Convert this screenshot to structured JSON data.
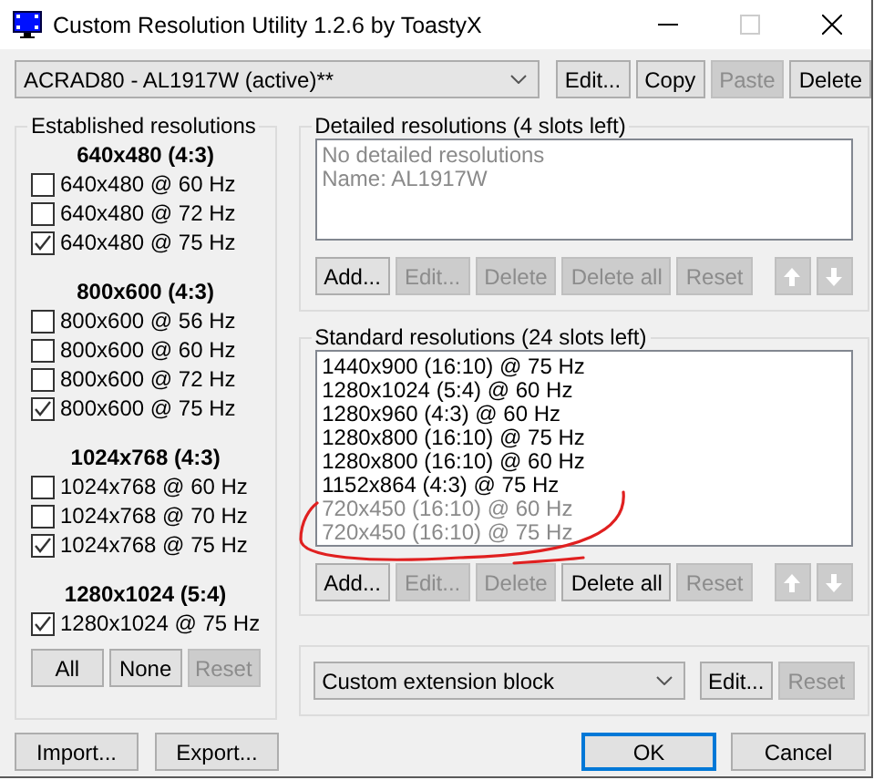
{
  "window": {
    "title": "Custom Resolution Utility 1.2.6 by ToastyX"
  },
  "display_select": {
    "value": "ACRAD80 - AL1917W (active)**"
  },
  "top_buttons": [
    {
      "label": "Edit...",
      "disabled": false
    },
    {
      "label": "Copy",
      "disabled": false
    },
    {
      "label": "Paste",
      "disabled": true
    },
    {
      "label": "Delete",
      "disabled": false
    }
  ],
  "established": {
    "title": "Established resolutions",
    "groups": [
      {
        "heading": "640x480 (4:3)",
        "items": [
          {
            "label": "640x480 @ 60 Hz",
            "checked": false
          },
          {
            "label": "640x480 @ 72 Hz",
            "checked": false
          },
          {
            "label": "640x480 @ 75 Hz",
            "checked": true
          }
        ]
      },
      {
        "heading": "800x600 (4:3)",
        "items": [
          {
            "label": "800x600 @ 56 Hz",
            "checked": false
          },
          {
            "label": "800x600 @ 60 Hz",
            "checked": false
          },
          {
            "label": "800x600 @ 72 Hz",
            "checked": false
          },
          {
            "label": "800x600 @ 75 Hz",
            "checked": true
          }
        ]
      },
      {
        "heading": "1024x768 (4:3)",
        "items": [
          {
            "label": "1024x768 @ 60 Hz",
            "checked": false
          },
          {
            "label": "1024x768 @ 70 Hz",
            "checked": false
          },
          {
            "label": "1024x768 @ 75 Hz",
            "checked": true
          }
        ]
      },
      {
        "heading": "1280x1024 (5:4)",
        "items": [
          {
            "label": "1280x1024 @ 75 Hz",
            "checked": true
          }
        ]
      }
    ],
    "buttons": [
      {
        "label": "All",
        "disabled": false
      },
      {
        "label": "None",
        "disabled": false
      },
      {
        "label": "Reset",
        "disabled": true
      }
    ]
  },
  "detailed": {
    "title": "Detailed resolutions (4 slots left)",
    "items": [
      {
        "label": "No detailed resolutions",
        "disabled": true
      },
      {
        "label": "Name: AL1917W",
        "disabled": true
      }
    ],
    "buttons": [
      {
        "label": "Add...",
        "disabled": false
      },
      {
        "label": "Edit...",
        "disabled": true
      },
      {
        "label": "Delete",
        "disabled": true
      },
      {
        "label": "Delete all",
        "disabled": true
      },
      {
        "label": "Reset",
        "disabled": true
      }
    ],
    "move_buttons": [
      {
        "kind": "up",
        "disabled": true
      },
      {
        "kind": "down",
        "disabled": true
      }
    ]
  },
  "standard": {
    "title": "Standard resolutions (24 slots left)",
    "items": [
      {
        "label": "1440x900 (16:10) @ 75 Hz",
        "disabled": false
      },
      {
        "label": "1280x1024 (5:4) @ 60 Hz",
        "disabled": false
      },
      {
        "label": "1280x960 (4:3) @ 60 Hz",
        "disabled": false
      },
      {
        "label": "1280x800 (16:10) @ 75 Hz",
        "disabled": false
      },
      {
        "label": "1280x800 (16:10) @ 60 Hz",
        "disabled": false
      },
      {
        "label": "1152x864 (4:3) @ 75 Hz",
        "disabled": false
      },
      {
        "label": "720x450 (16:10) @ 60 Hz",
        "disabled": true
      },
      {
        "label": "720x450 (16:10) @ 75 Hz",
        "disabled": true
      }
    ],
    "buttons": [
      {
        "label": "Add...",
        "disabled": false
      },
      {
        "label": "Edit...",
        "disabled": true
      },
      {
        "label": "Delete",
        "disabled": true
      },
      {
        "label": "Delete all",
        "disabled": false
      },
      {
        "label": "Reset",
        "disabled": true
      }
    ],
    "move_buttons": [
      {
        "kind": "up",
        "disabled": true
      },
      {
        "kind": "down",
        "disabled": true
      }
    ]
  },
  "extension": {
    "select": {
      "value": "Custom extension block"
    },
    "buttons": [
      {
        "label": "Edit...",
        "disabled": false
      },
      {
        "label": "Reset",
        "disabled": true
      }
    ]
  },
  "bottom_buttons": [
    {
      "label": "Import...",
      "disabled": false
    },
    {
      "label": "Export...",
      "disabled": false
    }
  ],
  "dialog_buttons": [
    {
      "label": "OK",
      "default": true
    },
    {
      "label": "Cancel",
      "default": false
    }
  ]
}
